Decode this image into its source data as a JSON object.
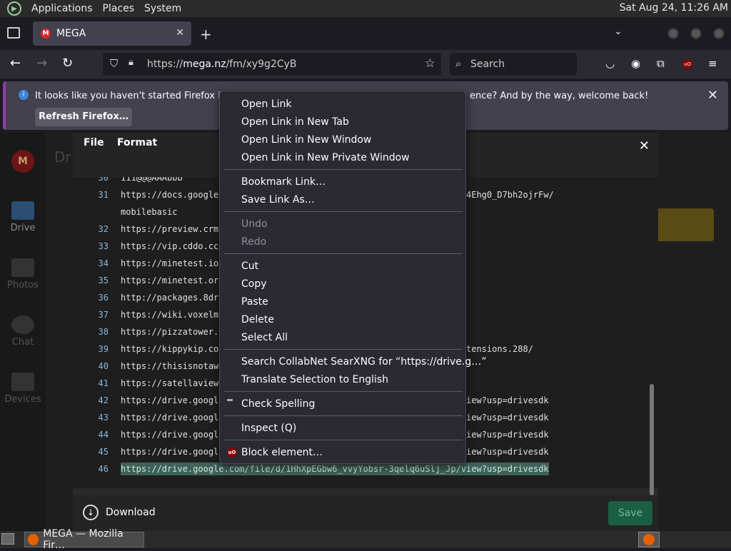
{
  "top_panel": {
    "menus": [
      "Applications",
      "Places",
      "System"
    ],
    "clock": "Sat Aug 24, 11:26 AM"
  },
  "browser": {
    "tab_title": "MEGA",
    "url_prefix": "https://",
    "url_host": "mega.nz",
    "url_path": "/fm/xy9g2CyB",
    "search_placeholder": "Search"
  },
  "notification": {
    "message_start": "It looks like you haven't started Firefox in a w",
    "message_end": "ence? And by the way, welcome back!",
    "button": "Refresh Firefox…"
  },
  "mega": {
    "logo": "M",
    "title": "Dr",
    "sidebar": [
      "Drive",
      "Photos",
      "Chat",
      "Devices"
    ]
  },
  "editor": {
    "menu": [
      "File",
      "Format"
    ],
    "lines": [
      {
        "num": "30",
        "text": "111@@@AAAbbb"
      },
      {
        "num": "31",
        "text": "https://docs.google",
        "tail": "4Ehg0_D7bh2ojrFw/"
      },
      {
        "num": "",
        "text": "mobilebasic"
      },
      {
        "num": "32",
        "text": "https://preview.crm"
      },
      {
        "num": "33",
        "text": "https://vip.cddo.cc"
      },
      {
        "num": "34",
        "text": "https://minetest.io"
      },
      {
        "num": "35",
        "text": "https://minetest.or"
      },
      {
        "num": "36",
        "text": "http://packages.8dr"
      },
      {
        "num": "37",
        "text": "https://wiki.voxelm"
      },
      {
        "num": "38",
        "text": "https://pizzatower."
      },
      {
        "num": "39",
        "text": "https://kippykip.co",
        "tail": "tensions.288/"
      },
      {
        "num": "40",
        "text": "https://thisisnotaw"
      },
      {
        "num": "41",
        "text": "https://satellaview"
      },
      {
        "num": "42",
        "text": "https://drive.googl",
        "tail": "iew?usp=drivesdk"
      },
      {
        "num": "43",
        "text": "https://drive.googl",
        "tail": "iew?usp=drivesdk"
      },
      {
        "num": "44",
        "text": "https://drive.googl",
        "tail": "iew?usp=drivesdk"
      },
      {
        "num": "45",
        "text": "https://drive.googl",
        "tail": "iew?usp=drivesdk"
      },
      {
        "num": "46",
        "text": "https://drive.google.com/file/d/1HhXpEGbw6_vvyYobsr-3qelq6uSlj_Jp/view?usp=drivesdk",
        "selected": true
      }
    ],
    "download": "Download",
    "save": "Save"
  },
  "context_menu": {
    "group1": [
      "Open Link",
      "Open Link in New Tab",
      "Open Link in New Window",
      "Open Link in New Private Window"
    ],
    "group2": [
      "Bookmark Link…",
      "Save Link As…"
    ],
    "group3": [
      "Undo",
      "Redo"
    ],
    "group4": [
      "Cut",
      "Copy",
      "Paste",
      "Delete",
      "Select All"
    ],
    "group5": [
      "Search CollabNet SearXNG for “https://drive.g…”",
      "Translate Selection to English"
    ],
    "group6": [
      "Check Spelling"
    ],
    "group7": [
      "Inspect (Q)"
    ],
    "group8": [
      "Block element…"
    ],
    "ublock_badge": "uO"
  },
  "taskbar": {
    "task_title": "MEGA — Mozilla Fir…"
  }
}
